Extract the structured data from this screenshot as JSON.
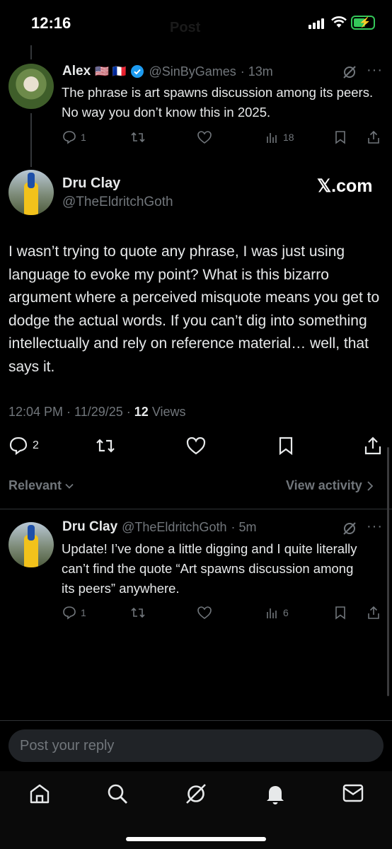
{
  "status_bar": {
    "time": "12:16",
    "header_ghost": "Post"
  },
  "parent_post": {
    "name": "Alex",
    "flags": "🇺🇸 🇫🇷",
    "handle": "@SinByGames",
    "time": "· 13m",
    "text": "The phrase is art spawns discussion among its peers. No way you don’t know this in 2025.",
    "replies": "1",
    "views": "18"
  },
  "main_post": {
    "name": "Dru Clay",
    "handle": "@TheEldritchGoth",
    "watermark": "𝕏.com",
    "text": "I wasn’t trying to quote any phrase, I was just using language to evoke my point? What is this bizarro argument where a perceived misquote means you get to dodge the actual words. If you can’t dig into something intellectually and rely on reference material… well, that says it.",
    "timestamp": "12:04 PM · 11/29/25 · ",
    "views_count": "12",
    "views_label": " Views",
    "replies": "2"
  },
  "sort_bar": {
    "relevant": "Relevant",
    "view_activity": "View activity"
  },
  "reply_post": {
    "name": "Dru Clay",
    "handle": "@TheEldritchGoth",
    "time": "· 5m",
    "text": "Update! I’ve done a little digging and I quite literally can’t find the quote “Art spawns discussion among its peers” anywhere.",
    "replies": "1",
    "views": "6"
  },
  "reply_input": {
    "placeholder": "Post your reply"
  },
  "colors": {
    "verified": "#1d9bf0",
    "background": "#000000",
    "muted": "#71767b"
  }
}
